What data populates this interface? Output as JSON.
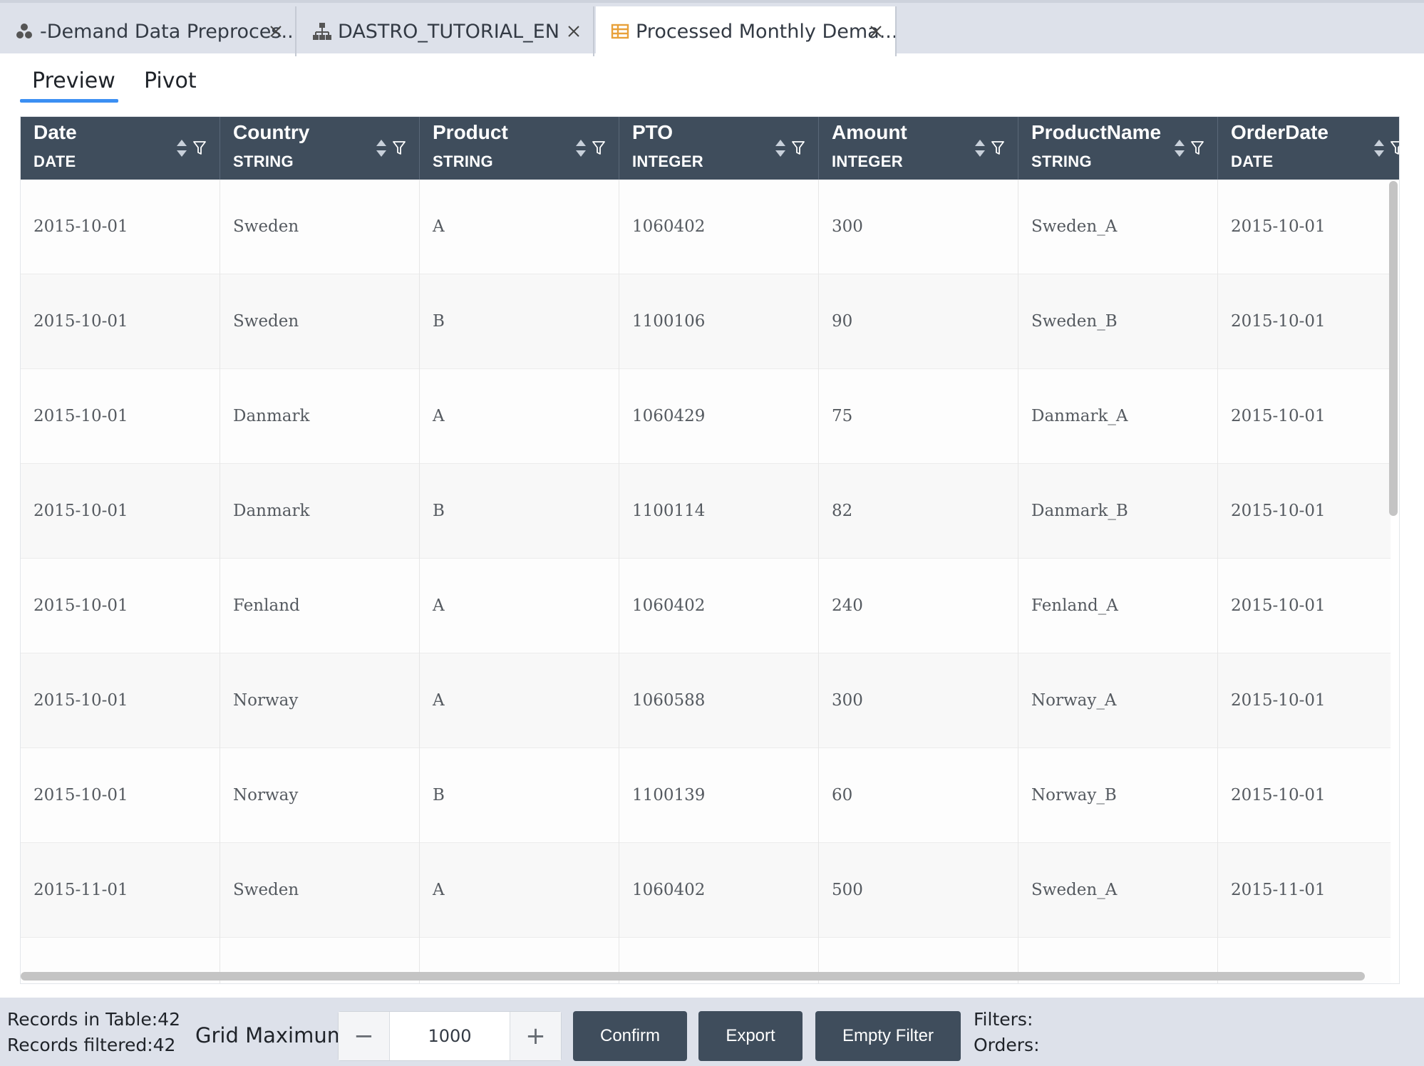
{
  "tabs": [
    {
      "label": "-Demand Data Preproces...",
      "icon": "workflow-icon",
      "active": false
    },
    {
      "label": "DASTRO_TUTORIAL_EN",
      "icon": "hierarchy-icon",
      "active": false
    },
    {
      "label": "Processed Monthly Dema...",
      "icon": "table-icon",
      "active": true
    }
  ],
  "subtabs": {
    "preview": "Preview",
    "pivot": "Pivot",
    "active": "Preview"
  },
  "colors": {
    "header_bg": "#3f4d5c",
    "accent": "#3b8ff3",
    "tabbar_bg": "#dde1ea"
  },
  "columns": [
    {
      "name": "Date",
      "type": "DATE"
    },
    {
      "name": "Country",
      "type": "STRING"
    },
    {
      "name": "Product",
      "type": "STRING"
    },
    {
      "name": "PTO",
      "type": "INTEGER"
    },
    {
      "name": "Amount",
      "type": "INTEGER"
    },
    {
      "name": "ProductName",
      "type": "STRING"
    },
    {
      "name": "OrderDate",
      "type": "DATE"
    }
  ],
  "rows": [
    [
      "2015-10-01",
      "Sweden",
      "A",
      "1060402",
      "300",
      "Sweden_A",
      "2015-10-01"
    ],
    [
      "2015-10-01",
      "Sweden",
      "B",
      "1100106",
      "90",
      "Sweden_B",
      "2015-10-01"
    ],
    [
      "2015-10-01",
      "Danmark",
      "A",
      "1060429",
      "75",
      "Danmark_A",
      "2015-10-01"
    ],
    [
      "2015-10-01",
      "Danmark",
      "B",
      "1100114",
      "82",
      "Danmark_B",
      "2015-10-01"
    ],
    [
      "2015-10-01",
      "Fenland",
      "A",
      "1060402",
      "240",
      "Fenland_A",
      "2015-10-01"
    ],
    [
      "2015-10-01",
      "Norway",
      "A",
      "1060588",
      "300",
      "Norway_A",
      "2015-10-01"
    ],
    [
      "2015-10-01",
      "Norway",
      "B",
      "1100139",
      "60",
      "Norway_B",
      "2015-10-01"
    ],
    [
      "2015-11-01",
      "Sweden",
      "A",
      "1060402",
      "500",
      "Sweden_A",
      "2015-11-01"
    ],
    [
      "",
      "",
      "",
      "",
      "",
      "",
      ""
    ]
  ],
  "footer": {
    "records_in_table": "Records in Table:42",
    "records_filtered": "Records filtered:42",
    "grid_maximum_label": "Grid Maximum",
    "grid_maximum_value": "1000",
    "minus": "−",
    "plus": "+",
    "confirm": "Confirm",
    "export": "Export",
    "empty_filter": "Empty Filter",
    "filters": "Filters:",
    "orders": "Orders:"
  }
}
